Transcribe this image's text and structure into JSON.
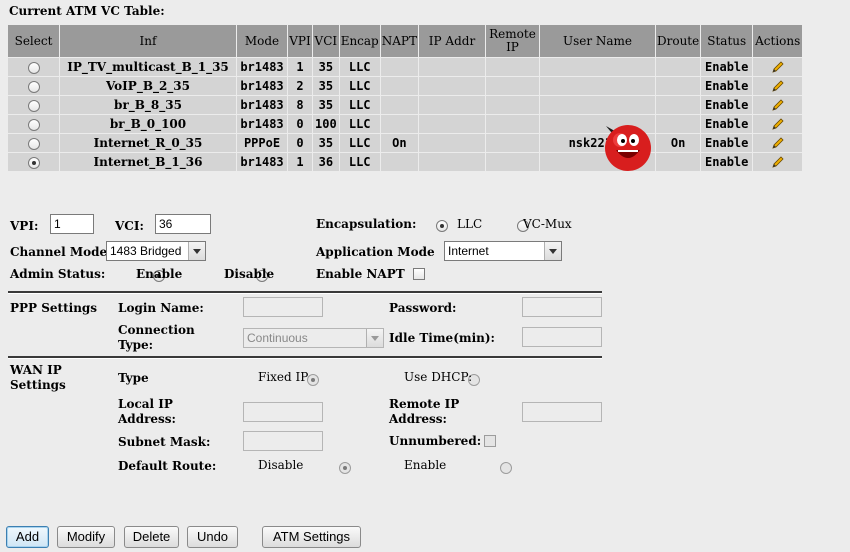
{
  "table": {
    "title": "Current ATM VC Table:",
    "headers": [
      "Select",
      "Inf",
      "Mode",
      "VPI",
      "VCI",
      "Encap",
      "NAPT",
      "IP Addr",
      "Remote IP",
      "User Name",
      "Droute",
      "Status",
      "Actions"
    ],
    "rows": [
      {
        "selected": false,
        "inf": "IP_TV_multicast_B_1_35",
        "mode": "br1483",
        "vpi": "1",
        "vci": "35",
        "encap": "LLC",
        "napt": "",
        "ip": "",
        "remote": "",
        "user": "",
        "droute": "",
        "status": "Enable"
      },
      {
        "selected": false,
        "inf": "VoIP_B_2_35",
        "mode": "br1483",
        "vpi": "2",
        "vci": "35",
        "encap": "LLC",
        "napt": "",
        "ip": "",
        "remote": "",
        "user": "",
        "droute": "",
        "status": "Enable"
      },
      {
        "selected": false,
        "inf": "br_B_8_35",
        "mode": "br1483",
        "vpi": "8",
        "vci": "35",
        "encap": "LLC",
        "napt": "",
        "ip": "",
        "remote": "",
        "user": "",
        "droute": "",
        "status": "Enable"
      },
      {
        "selected": false,
        "inf": "br_B_0_100",
        "mode": "br1483",
        "vpi": "0",
        "vci": "100",
        "encap": "LLC",
        "napt": "",
        "ip": "",
        "remote": "",
        "user": "",
        "droute": "",
        "status": "Enable"
      },
      {
        "selected": false,
        "inf": "Internet_R_0_35",
        "mode": "PPPoE",
        "vpi": "0",
        "vci": "35",
        "encap": "LLC",
        "napt": "On",
        "ip": "",
        "remote": "",
        "user": "nsk2210-",
        "droute": "On",
        "status": "Enable"
      },
      {
        "selected": true,
        "inf": "Internet_B_1_36",
        "mode": "br1483",
        "vpi": "1",
        "vci": "36",
        "encap": "LLC",
        "napt": "",
        "ip": "",
        "remote": "",
        "user": "",
        "droute": "",
        "status": "Enable"
      }
    ]
  },
  "form": {
    "vpi_label": "VPI:",
    "vpi_value": "1",
    "vci_label": "VCI:",
    "vci_value": "36",
    "encap_label": "Encapsulation:",
    "encap_llc": "LLC",
    "encap_vcmux": "VC-Mux",
    "channel_mode_label": "Channel Mode",
    "channel_mode_value": "1483 Bridged",
    "app_mode_label": "Application Mode",
    "app_mode_value": "Internet",
    "admin_status_label": "Admin Status:",
    "admin_enable": "Enable",
    "admin_disable": "Disable",
    "enable_napt_label": "Enable NAPT"
  },
  "ppp": {
    "section_label": "PPP Settings",
    "login_label": "Login Name:",
    "password_label": "Password:",
    "connection_type_label": "Connection Type:",
    "connection_type_value": "Continuous",
    "idle_time_label": "Idle Time(min):"
  },
  "wan": {
    "section_label": "WAN IP Settings",
    "type_label": "Type",
    "fixed_ip": "Fixed IP",
    "use_dhcp": "Use DHCP:",
    "local_ip_label": "Local IP Address:",
    "remote_ip_label": "Remote IP Address:",
    "subnet_label": "Subnet Mask:",
    "unnumbered_label": "Unnumbered:",
    "default_route_label": "Default Route:",
    "dr_disable": "Disable",
    "dr_enable": "Enable"
  },
  "buttons": {
    "add": "Add",
    "modify": "Modify",
    "delete": "Delete",
    "undo": "Undo",
    "atm_settings": "ATM Settings"
  },
  "icons": {
    "edit": "pencil-icon",
    "mascot": "red-ball-mascot"
  }
}
